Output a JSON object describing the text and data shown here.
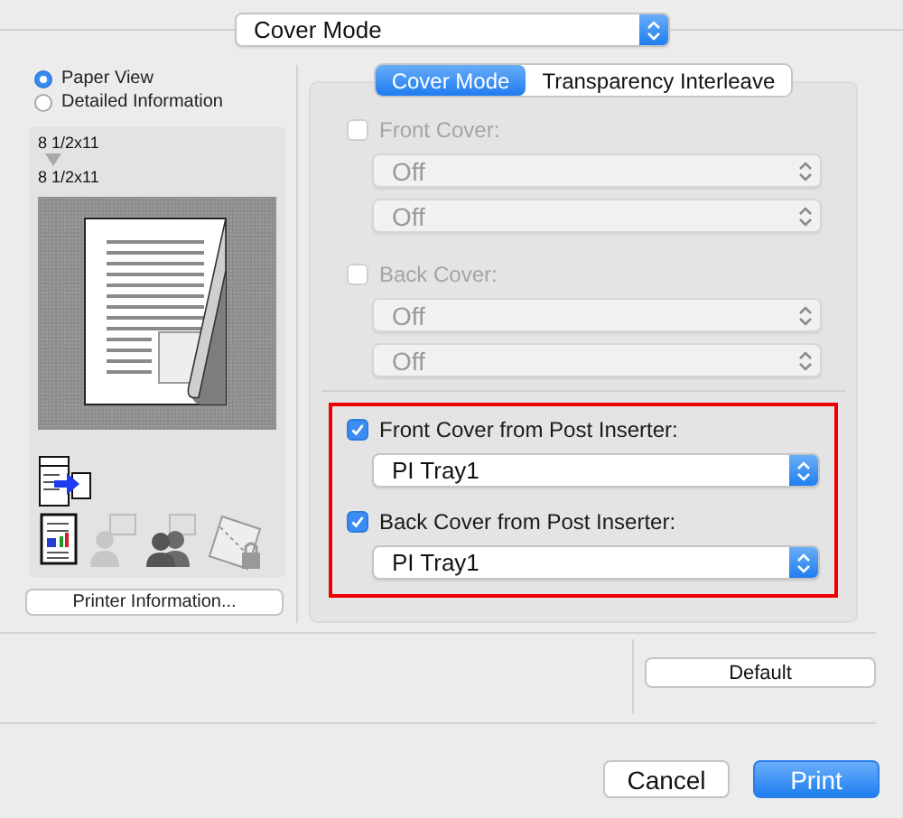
{
  "mode_popup": {
    "value": "Cover Mode"
  },
  "view_options": [
    {
      "label": "Paper View",
      "selected": true
    },
    {
      "label": "Detailed Information",
      "selected": false
    }
  ],
  "preview": {
    "source_size": "8 1/2x11",
    "output_size": "8 1/2x11"
  },
  "printer_info_button": "Printer Information...",
  "tabs": [
    {
      "label": "Cover Mode",
      "selected": true
    },
    {
      "label": "Transparency Interleave",
      "selected": false
    }
  ],
  "cover_options": [
    {
      "label": "Front Cover:",
      "checked": false,
      "disabled": true,
      "popups": [
        "Off",
        "Off"
      ]
    },
    {
      "label": "Back Cover:",
      "checked": false,
      "disabled": true,
      "popups": [
        "Off",
        "Off"
      ]
    }
  ],
  "post_inserter": [
    {
      "label": "Front Cover from Post Inserter:",
      "checked": true,
      "disabled": false,
      "tray": "PI Tray1"
    },
    {
      "label": "Back Cover from Post Inserter:",
      "checked": true,
      "disabled": false,
      "tray": "PI Tray1"
    }
  ],
  "default_button": "Default",
  "buttons": [
    {
      "label": "Cancel",
      "kind": "normal"
    },
    {
      "label": "Print",
      "kind": "default"
    }
  ]
}
